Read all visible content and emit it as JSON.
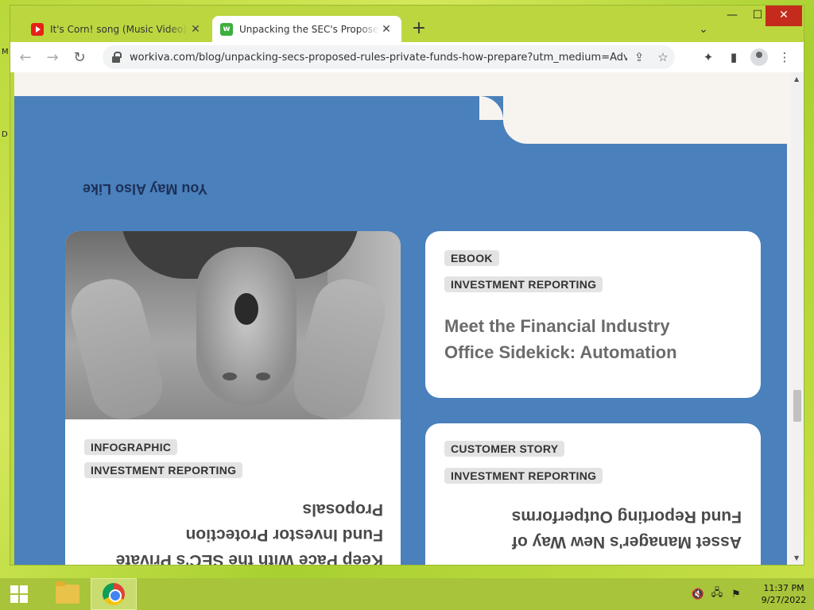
{
  "desktop": {
    "left_edge_labels": [
      "M",
      "D"
    ]
  },
  "browser": {
    "tabs": [
      {
        "title": "It's Corn! song (Music Video) - Yo",
        "favicon": "youtube-icon"
      },
      {
        "title": "Unpacking the SEC's Proposed R",
        "favicon": "workiva-icon",
        "active": true
      }
    ],
    "new_tab": "+",
    "tab_search": "⌄",
    "window_controls": {
      "minimize": "—",
      "maximize": "☐",
      "close": "✕"
    },
    "nav": {
      "back": "←",
      "forward": "→",
      "reload": "↻"
    },
    "url": "workiva.com/blog/unpacking-secs-proposed-rules-private-funds-how-prepare?utm_medium=Adverti...",
    "omni_icons": {
      "share": "⇪",
      "bookmark": "☆"
    },
    "toolbar_icons": {
      "extensions": "✦",
      "sidepanel": "▮",
      "menu": "⋮"
    }
  },
  "page": {
    "section_title": "You May Also Like",
    "cards": [
      {
        "tags": [
          "INFOGRAPHIC",
          "INVESTMENT REPORTING"
        ],
        "title_lines": [
          "Keep Pace With the SEC's Private",
          "Fund Investor Protection",
          "Proposals"
        ]
      },
      {
        "tags": [
          "EBOOK",
          "INVESTMENT REPORTING"
        ],
        "title_lines": [
          "Meet the Financial Industry",
          "Office Sidekick: Automation"
        ]
      },
      {
        "tags": [
          "CUSTOMER STORY",
          "INVESTMENT REPORTING"
        ],
        "title_lines": [
          "Asset Manager's New Way of",
          "Fund Reporting Outperforms"
        ]
      }
    ]
  },
  "scrollbar": {
    "up": "▲",
    "down": "▼"
  },
  "taskbar": {
    "tray_icons": {
      "volume": "🔇",
      "network": "🖧",
      "flag": "⚑"
    },
    "time": "11:37 PM",
    "date": "9/27/2022"
  }
}
